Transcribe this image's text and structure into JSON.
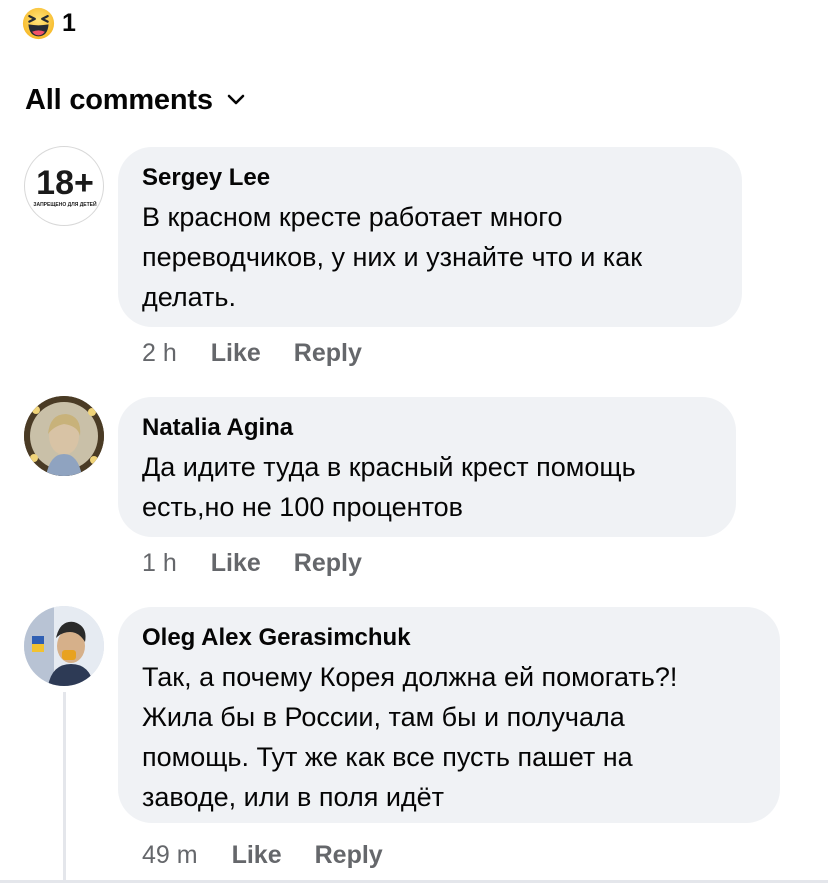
{
  "reaction": {
    "icon": "laughing-emoji-icon",
    "count": "1"
  },
  "filter": {
    "label": "All comments",
    "icon": "chevron-down-icon"
  },
  "comments": [
    {
      "author": "Sergey Lee",
      "avatar": "18plus-avatar",
      "avatar_text": "18+",
      "avatar_subtext": "ЗАПРЕЩЕНО ДЛЯ ДЕТЕЙ",
      "text": "В красном кресте работает много\nпереводчиков, у них и узнайте что и как\nделать.",
      "time": "2 h",
      "like_label": "Like",
      "reply_label": "Reply"
    },
    {
      "author": "Natalia Agina",
      "avatar": "photo-avatar",
      "text": "Да идите туда в красный крест помощь\nесть,но не 100 процентов",
      "time": "1 h",
      "like_label": "Like",
      "reply_label": "Reply"
    },
    {
      "author": "Oleg Alex Gerasimchuk",
      "avatar": "photo-avatar",
      "text": "Так, а почему Корея должна ей помогать?!\nЖила бы в России, там бы и получала\nпомощь. Тут же как все пусть пашет на\nзаводе, или в поля идёт",
      "time": "49 m",
      "like_label": "Like",
      "reply_label": "Reply"
    }
  ],
  "colors": {
    "bubble": "#f0f2f5",
    "meta": "#65676b",
    "text": "#050505",
    "emoji": "#f7b928"
  }
}
